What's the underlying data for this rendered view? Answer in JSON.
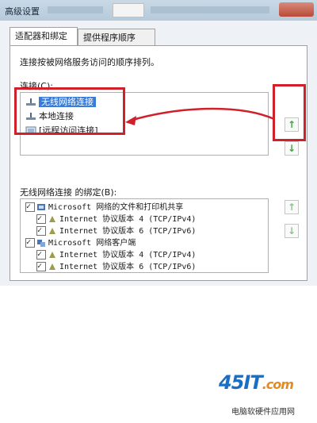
{
  "window": {
    "title": "高级设置"
  },
  "tabs": [
    {
      "label": "适配器和绑定"
    },
    {
      "label": "提供程序顺序"
    }
  ],
  "panel": {
    "description": "连接按被网络服务访问的顺序排列。",
    "connections_label": "连接(C):",
    "connections": [
      {
        "label": "无线网络连接",
        "selected": true,
        "icon": "network-adapter-icon"
      },
      {
        "label": "本地连接",
        "selected": false,
        "icon": "network-adapter-icon"
      },
      {
        "label": "[远程访问连接]",
        "selected": false,
        "icon": "remote-access-icon"
      }
    ],
    "bindings_label": "无线网络连接 的绑定(B):",
    "bindings": [
      {
        "label": "Microsoft 网络的文件和打印机共享",
        "checked": true,
        "indent": 0
      },
      {
        "label": "Internet 协议版本 4 (TCP/IPv4)",
        "checked": true,
        "indent": 1
      },
      {
        "label": "Internet 协议版本 6 (TCP/IPv6)",
        "checked": true,
        "indent": 1
      },
      {
        "label": "Microsoft 网络客户端",
        "checked": true,
        "indent": 0
      },
      {
        "label": "Internet 协议版本 4 (TCP/IPv4)",
        "checked": true,
        "indent": 1
      },
      {
        "label": "Internet 协议版本 6 (TCP/IPv6)",
        "checked": true,
        "indent": 1
      }
    ],
    "up_arrow": "↑",
    "down_arrow": "↓"
  },
  "watermark": {
    "logo": "45IT",
    "logo_suffix": ".com",
    "subtitle": "电脑软硬件应用网"
  },
  "colors": {
    "highlight_red": "#d0202a",
    "selection_blue": "#3a7bd5",
    "arrow_green": "#46a046"
  }
}
